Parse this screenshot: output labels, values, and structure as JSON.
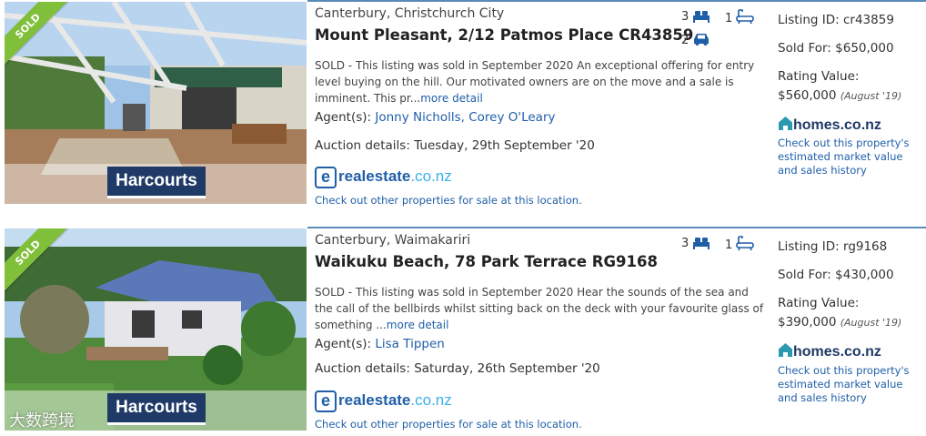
{
  "listings": [
    {
      "badge": "SOLD",
      "agency": "Harcourts",
      "region": "Canterbury, Christchurch City",
      "title": "Mount Pleasant, 2/12 Patmos Place CR43859",
      "description": "SOLD - This listing was sold in September 2020 An exceptional offering for entry level buying on the hill. Our motivated owners are on the move and a sale is imminent. This pr...",
      "more_link": "more detail",
      "agents_label": "Agent(s):",
      "agents": "Jonny Nicholls, Corey O'Leary",
      "auction_label": "Auction details:",
      "auction": "Tuesday, 29th September '20",
      "realestate_brand": "realestate",
      "realestate_tld": ".co.nz",
      "realestate_link": "Check out other properties for sale at this location.",
      "bedrooms": "3",
      "bathrooms": "1",
      "garages": "2",
      "listing_id_label": "Listing ID:",
      "listing_id": "cr43859",
      "sold_for_label": "Sold For:",
      "sold_for": "$650,000",
      "rating_label": "Rating Value:",
      "rating_value": "$560,000",
      "rating_date": "(August '19)",
      "homes_brand": "homes.co.nz",
      "homes_note": "Check out this property's estimated market value and sales history"
    },
    {
      "badge": "SOLD",
      "agency": "Harcourts",
      "region": "Canterbury, Waimakariri",
      "title": "Waikuku Beach, 78 Park Terrace RG9168",
      "description": "SOLD - This listing was sold in September 2020 Hear the sounds of the sea and the call of the bellbirds whilst sitting back on the deck with your favourite glass of something ...",
      "more_link": "more detail",
      "agents_label": "Agent(s):",
      "agents": "Lisa Tippen",
      "auction_label": "Auction details:",
      "auction": "Saturday, 26th September '20",
      "realestate_brand": "realestate",
      "realestate_tld": ".co.nz",
      "realestate_link": "Check out other properties for sale at this location.",
      "bedrooms": "3",
      "bathrooms": "1",
      "listing_id_label": "Listing ID:",
      "listing_id": "rg9168",
      "sold_for_label": "Sold For:",
      "sold_for": "$430,000",
      "rating_label": "Rating Value:",
      "rating_value": "$390,000",
      "rating_date": "(August '19)",
      "homes_brand": "homes.co.nz",
      "homes_note": "Check out this property's estimated market value and sales history"
    }
  ],
  "watermark": "大数跨境",
  "colors": {
    "accent": "#1f5fa8",
    "sold_ribbon": "#7fbf3a",
    "agency": "#1f3a66",
    "divider": "#5a8bb8"
  },
  "icons": [
    "bed-icon",
    "bath-icon",
    "car-icon",
    "homes-house-icon",
    "realestate-e-icon"
  ]
}
